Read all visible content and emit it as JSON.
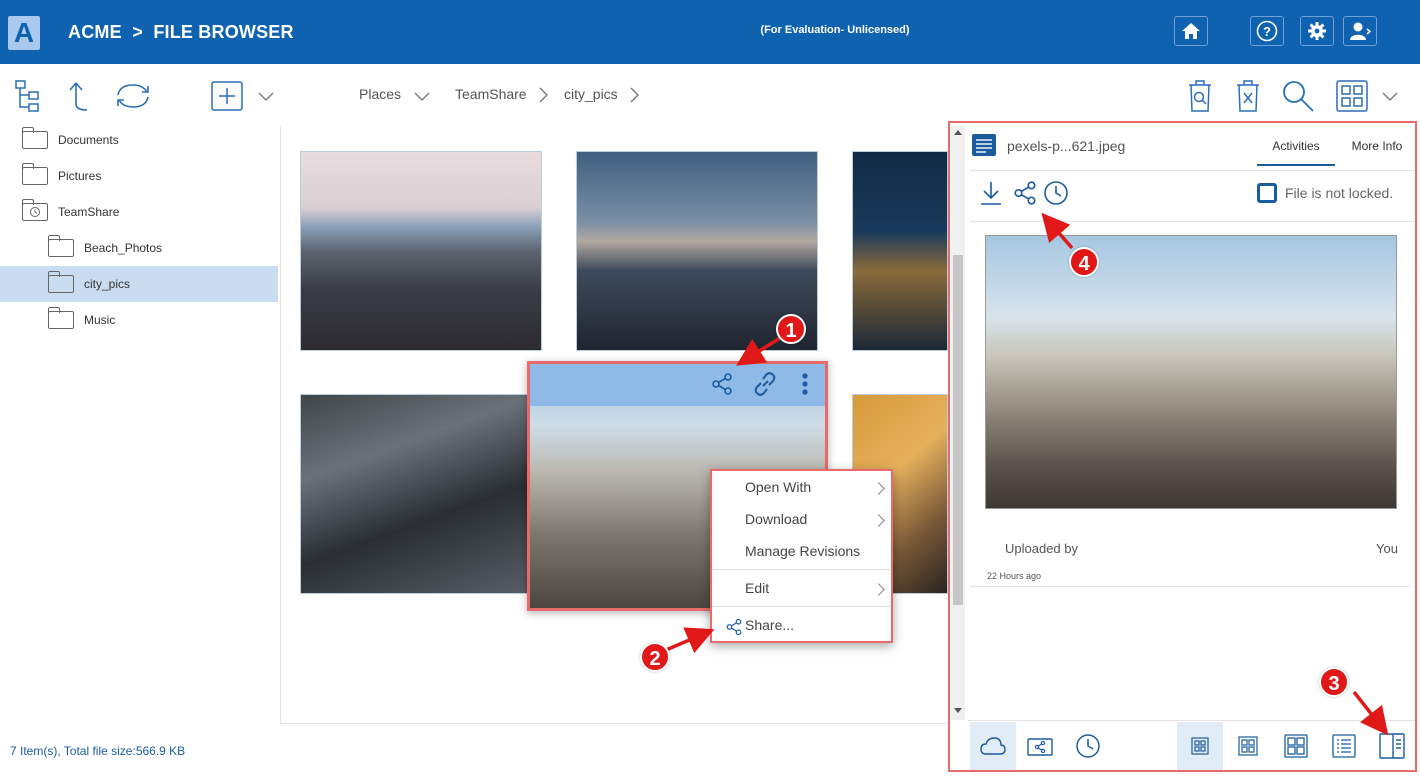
{
  "header": {
    "logo_letter": "A",
    "title": "ACME  >  FILE BROWSER",
    "evaluation_notice": "(For Evaluation- Unlicensed)"
  },
  "toolbar": {
    "breadcrumb": [
      "Places",
      "TeamShare",
      "city_pics"
    ]
  },
  "sidebar": {
    "items": [
      {
        "label": "Documents",
        "icon": "folder-icon"
      },
      {
        "label": "Pictures",
        "icon": "folder-icon"
      },
      {
        "label": "TeamShare",
        "icon": "shared-folder-icon"
      },
      {
        "label": "Beach_Photos",
        "icon": "folder-icon"
      },
      {
        "label": "city_pics",
        "icon": "folder-icon",
        "selected": true
      },
      {
        "label": "Music",
        "icon": "folder-icon"
      }
    ]
  },
  "status": {
    "text": "7 Item(s), Total file size:566.9 KB"
  },
  "context_menu": {
    "items": [
      "Open With",
      "Download",
      "Manage Revisions",
      "Edit",
      "Share..."
    ]
  },
  "details_panel": {
    "filename": "pexels-p...621.jpeg",
    "tabs": [
      "Activities",
      "More Info"
    ],
    "lock_status": "File is not locked.",
    "activity": {
      "label": "Uploaded by",
      "user": "You",
      "time": "22 Hours ago"
    }
  },
  "annotations": [
    "1",
    "2",
    "3",
    "4"
  ],
  "colors": {
    "brand": "#0e62b0",
    "highlight": "#e86a6a",
    "badge": "#e01818",
    "selected_row": "#c9dcf0"
  }
}
